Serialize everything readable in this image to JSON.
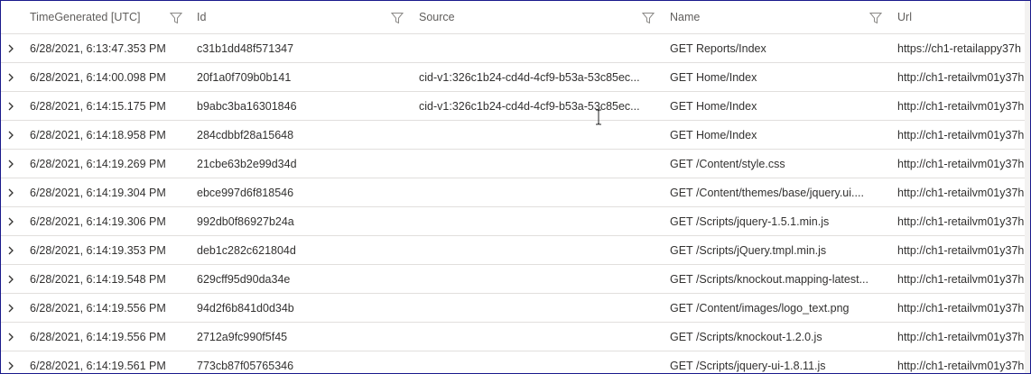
{
  "columns": {
    "time": "TimeGenerated [UTC]",
    "id": "Id",
    "source": "Source",
    "name": "Name",
    "url": "Url"
  },
  "icons": {
    "filter": "filter-icon",
    "expand": "chevron-right-icon",
    "cursor": "text-cursor-icon"
  },
  "rows": [
    {
      "time": "6/28/2021, 6:13:47.353 PM",
      "id": "c31b1dd48f571347",
      "source": "",
      "name": "GET Reports/Index",
      "url": "https://ch1-retailappy37h"
    },
    {
      "time": "6/28/2021, 6:14:00.098 PM",
      "id": "20f1a0f709b0b141",
      "source": "cid-v1:326c1b24-cd4d-4cf9-b53a-53c85ec...",
      "name": "GET Home/Index",
      "url": "http://ch1-retailvm01y37h"
    },
    {
      "time": "6/28/2021, 6:14:15.175 PM",
      "id": "b9abc3ba16301846",
      "source": "cid-v1:326c1b24-cd4d-4cf9-b53a-53c85ec...",
      "name": "GET Home/Index",
      "url": "http://ch1-retailvm01y37h"
    },
    {
      "time": "6/28/2021, 6:14:18.958 PM",
      "id": "284cdbbf28a15648",
      "source": "",
      "name": "GET Home/Index",
      "url": "http://ch1-retailvm01y37h"
    },
    {
      "time": "6/28/2021, 6:14:19.269 PM",
      "id": "21cbe63b2e99d34d",
      "source": "",
      "name": "GET /Content/style.css",
      "url": "http://ch1-retailvm01y37h"
    },
    {
      "time": "6/28/2021, 6:14:19.304 PM",
      "id": "ebce997d6f818546",
      "source": "",
      "name": "GET /Content/themes/base/jquery.ui....",
      "url": "http://ch1-retailvm01y37h"
    },
    {
      "time": "6/28/2021, 6:14:19.306 PM",
      "id": "992db0f86927b24a",
      "source": "",
      "name": "GET /Scripts/jquery-1.5.1.min.js",
      "url": "http://ch1-retailvm01y37h"
    },
    {
      "time": "6/28/2021, 6:14:19.353 PM",
      "id": "deb1c282c621804d",
      "source": "",
      "name": "GET /Scripts/jQuery.tmpl.min.js",
      "url": "http://ch1-retailvm01y37h"
    },
    {
      "time": "6/28/2021, 6:14:19.548 PM",
      "id": "629cff95d90da34e",
      "source": "",
      "name": "GET /Scripts/knockout.mapping-latest...",
      "url": "http://ch1-retailvm01y37h"
    },
    {
      "time": "6/28/2021, 6:14:19.556 PM",
      "id": "94d2f6b841d0d34b",
      "source": "",
      "name": "GET /Content/images/logo_text.png",
      "url": "http://ch1-retailvm01y37h"
    },
    {
      "time": "6/28/2021, 6:14:19.556 PM",
      "id": "2712a9fc990f5f45",
      "source": "",
      "name": "GET /Scripts/knockout-1.2.0.js",
      "url": "http://ch1-retailvm01y37h"
    },
    {
      "time": "6/28/2021, 6:14:19.561 PM",
      "id": "773cb87f05765346",
      "source": "",
      "name": "GET /Scripts/jquery-ui-1.8.11.js",
      "url": "http://ch1-retailvm01y37h"
    }
  ]
}
